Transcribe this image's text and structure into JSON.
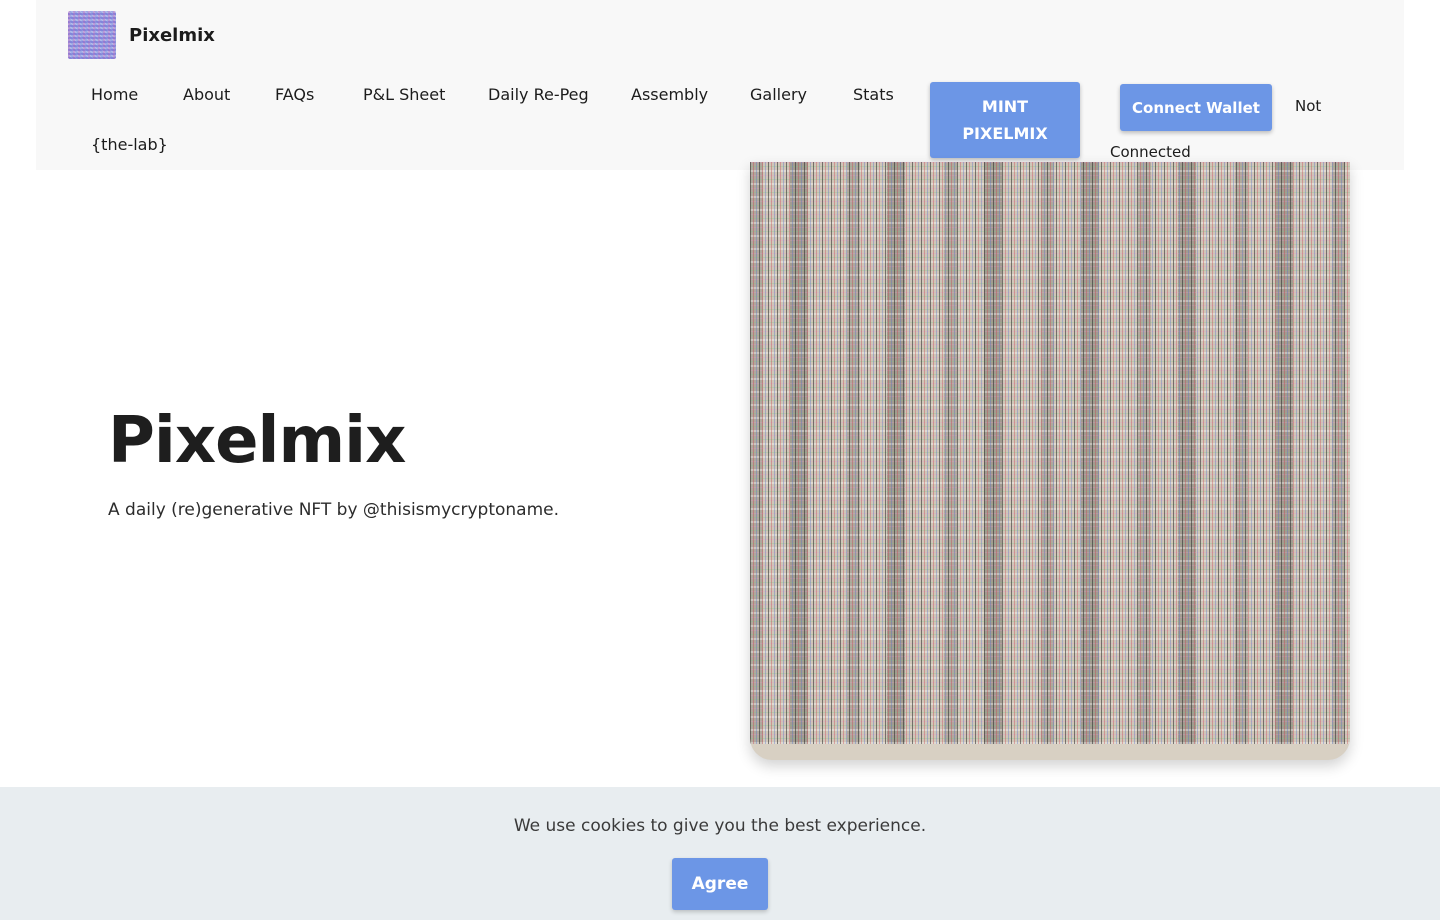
{
  "header": {
    "brand_name": "Pixelmix",
    "nav": [
      "Home",
      "About",
      "FAQs",
      "P&L Sheet",
      "Daily Re-Peg",
      "Assembly",
      "Gallery",
      "Stats",
      "{the-lab}"
    ],
    "mint_line1": "MINT",
    "mint_line2": "PIXELMIX",
    "connect_wallet": "Connect Wallet",
    "status_line1": "Not",
    "status_line2": "Connected"
  },
  "hero": {
    "title": "Pixelmix",
    "subtitle": "A daily (re)generative NFT by @thisismycryptoname."
  },
  "cookie": {
    "message": "We use cookies to give you the best experience.",
    "agree_label": "Agree"
  },
  "colors": {
    "accent": "#6c96e6",
    "header_bg": "#f8f8f8",
    "cookie_bg": "#e8edf0",
    "art_bg": "#d8d0c3"
  }
}
